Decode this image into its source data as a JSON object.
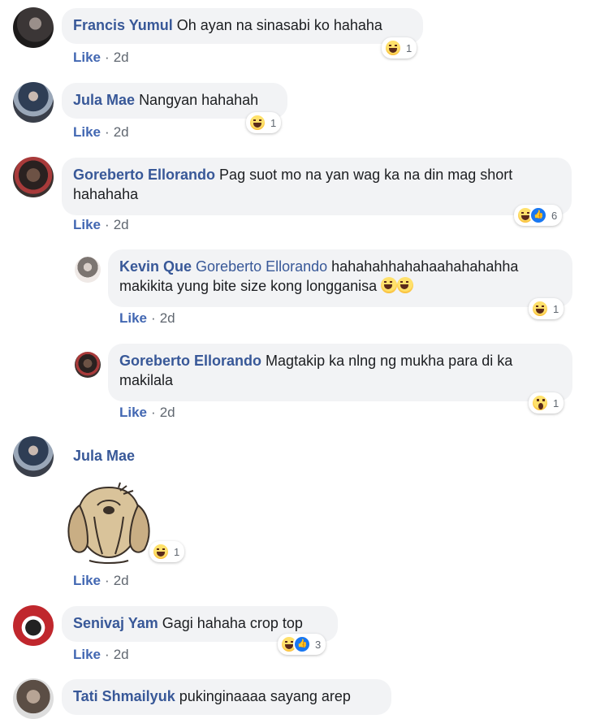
{
  "comments": [
    {
      "author": "Francis Yumul",
      "text": "Oh ayan na sinasabi ko hahaha",
      "like": "Like",
      "time": "2d",
      "reaction_count": "1"
    },
    {
      "author": "Jula Mae",
      "text": "Nangyan hahahah",
      "like": "Like",
      "time": "2d",
      "reaction_count": "1"
    },
    {
      "author": "Goreberto Ellorando",
      "text": "Pag suot mo na yan wag ka na din mag short",
      "text2": "hahahaha",
      "like": "Like",
      "time": "2d",
      "reaction_count": "6",
      "replies": [
        {
          "author": "Kevin Que",
          "mention": "Goreberto Ellorando",
          "text": "hahahahhahahaahahahahha",
          "text2": "makikita yung bite size kong longganisa",
          "like": "Like",
          "time": "2d",
          "reaction_count": "1"
        },
        {
          "author": "Goreberto Ellorando",
          "text": "Magtakip ka nlng ng mukha para di ka",
          "text2": "makilala",
          "like": "Like",
          "time": "2d",
          "reaction_count": "1"
        }
      ]
    },
    {
      "author": "Jula Mae",
      "sticker": "crying-dog-sticker",
      "like": "Like",
      "time": "2d",
      "reaction_count": "1"
    },
    {
      "author": "Senivaj Yam",
      "text": "Gagi hahaha crop top",
      "like": "Like",
      "time": "2d",
      "reaction_count": "3"
    },
    {
      "author": "Tati Shmailyuk",
      "text": "pukinginaaaa sayang arep"
    }
  ],
  "colors": {
    "author": "#385898",
    "bubble": "#f2f3f5",
    "like": "#4267b2",
    "meta": "#606770"
  }
}
